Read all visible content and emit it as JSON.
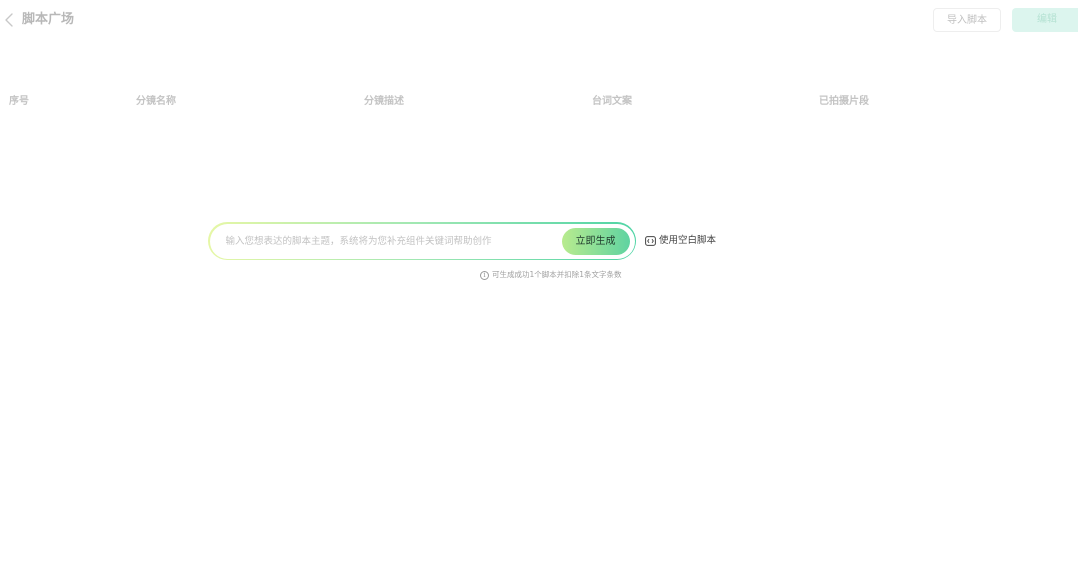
{
  "header": {
    "title": "脚本广场",
    "import_label": "导入脚本",
    "edit_label": "编辑"
  },
  "table": {
    "columns": [
      "序号",
      "分镜名称",
      "分镜描述",
      "台词文案",
      "已拍摄片段"
    ]
  },
  "generator": {
    "placeholder": "输入您想表达的脚本主题，系统将为您补充组件关键词帮助创作",
    "generate_label": "立即生成",
    "blank_script_label": "使用空白脚本",
    "hint": "可生成成功1个脚本并扣除1条文字条数"
  }
}
